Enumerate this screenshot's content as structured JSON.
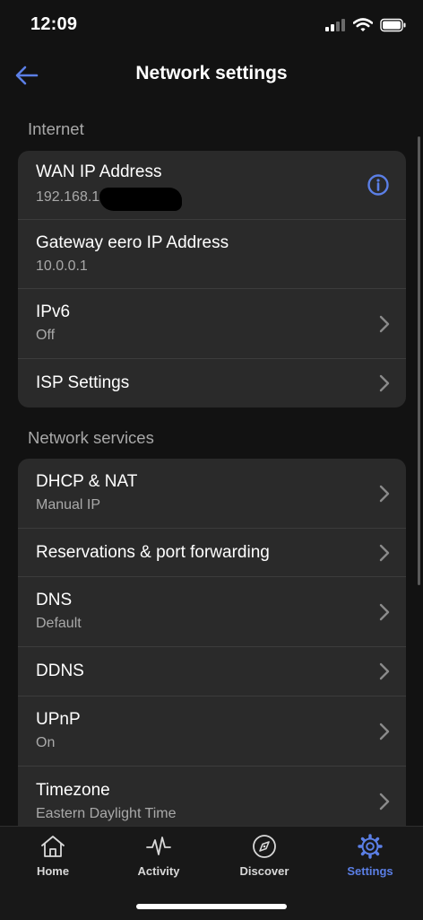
{
  "status_bar": {
    "time": "12:09"
  },
  "header": {
    "title": "Network settings",
    "back_icon": "arrow-left-icon"
  },
  "colors": {
    "accent": "#5b7fe6",
    "background": "#121212",
    "card": "#2a2a2a",
    "secondary_text": "#a9a9a9"
  },
  "sections": {
    "internet": {
      "title": "Internet",
      "rows": [
        {
          "label": "WAN IP Address",
          "value": "192.168.1",
          "end_icon": "info-icon"
        },
        {
          "label": "Gateway eero IP Address",
          "value": "10.0.0.1"
        },
        {
          "label": "IPv6",
          "value": "Off",
          "end_icon": "chevron-right-icon"
        },
        {
          "label": "ISP Settings",
          "end_icon": "chevron-right-icon"
        }
      ]
    },
    "network_services": {
      "title": "Network services",
      "rows": [
        {
          "label": "DHCP & NAT",
          "value": "Manual IP",
          "end_icon": "chevron-right-icon"
        },
        {
          "label": "Reservations & port forwarding",
          "end_icon": "chevron-right-icon"
        },
        {
          "label": "DNS",
          "value": "Default",
          "end_icon": "chevron-right-icon"
        },
        {
          "label": "DDNS",
          "end_icon": "chevron-right-icon"
        },
        {
          "label": "UPnP",
          "value": "On",
          "end_icon": "chevron-right-icon"
        },
        {
          "label": "Timezone",
          "value": "Eastern Daylight Time",
          "end_icon": "chevron-right-icon"
        }
      ]
    }
  },
  "tab_bar": {
    "tabs": [
      {
        "label": "Home",
        "icon": "house-icon"
      },
      {
        "label": "Activity",
        "icon": "pulse-icon"
      },
      {
        "label": "Discover",
        "icon": "compass-icon"
      },
      {
        "label": "Settings",
        "icon": "gear-icon",
        "active": true
      }
    ]
  }
}
